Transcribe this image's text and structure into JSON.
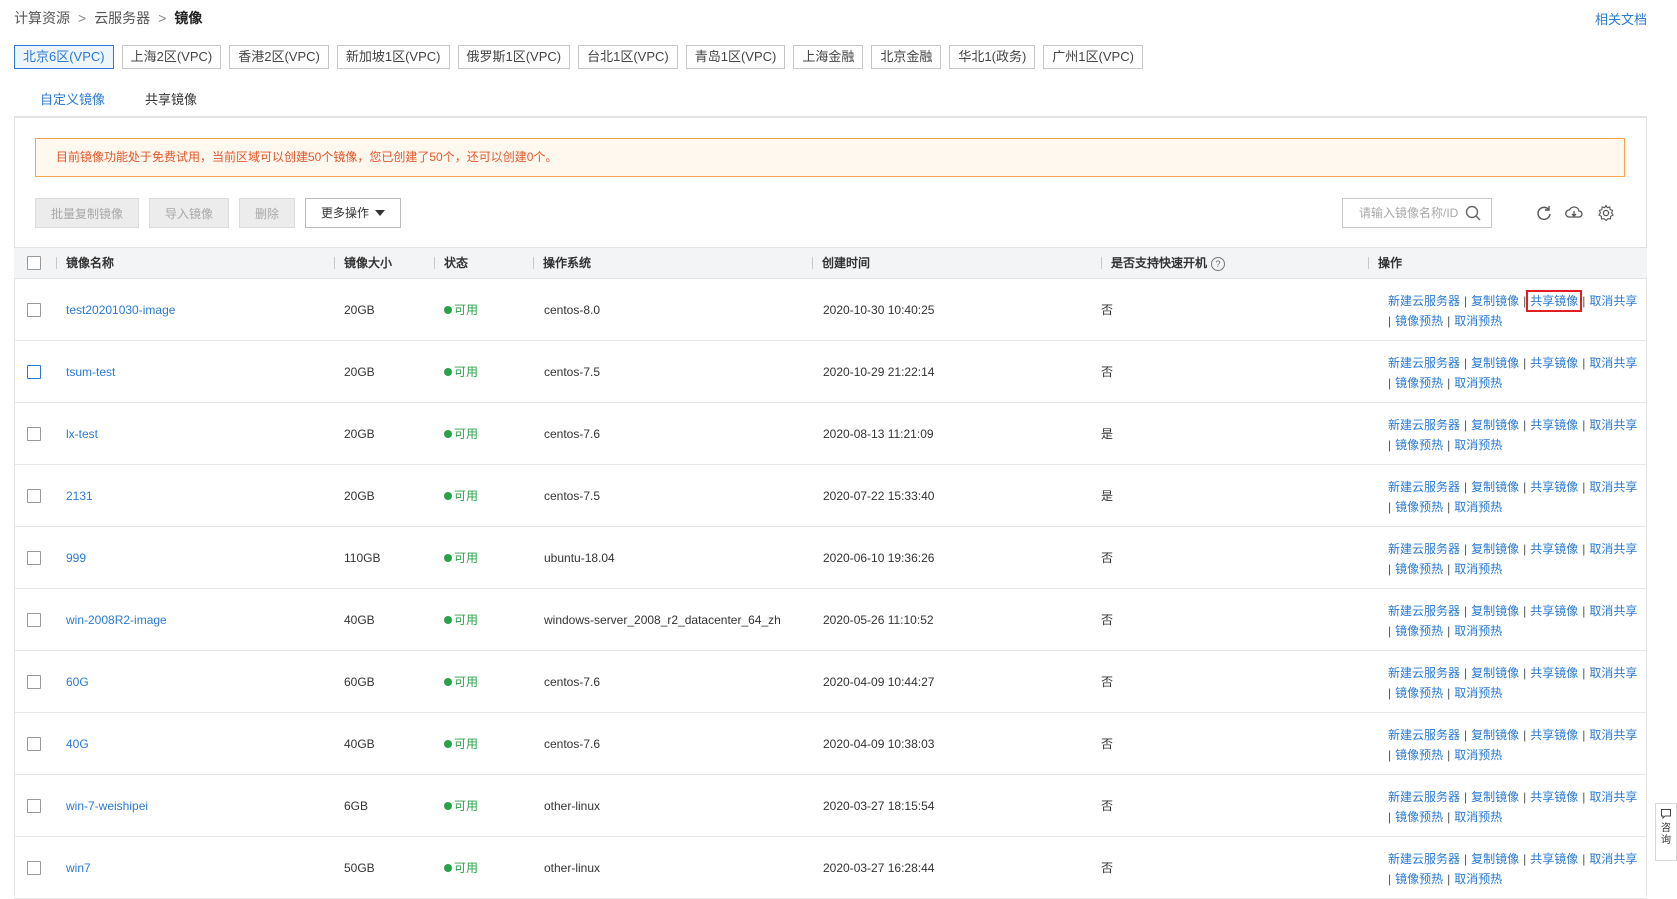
{
  "breadcrumb": {
    "items": [
      "计算资源",
      "云服务器",
      "镜像"
    ],
    "sep": ">"
  },
  "help_link": "相关文档",
  "regions": [
    "北京6区(VPC)",
    "上海2区(VPC)",
    "香港2区(VPC)",
    "新加坡1区(VPC)",
    "俄罗斯1区(VPC)",
    "台北1区(VPC)",
    "青岛1区(VPC)",
    "上海金融",
    "北京金融",
    "华北1(政务)",
    "广州1区(VPC)"
  ],
  "active_region": "北京6区(VPC)",
  "tabs": [
    "自定义镜像",
    "共享镜像"
  ],
  "notice": "目前镜像功能处于免费试用，当前区域可以创建50个镜像，您已创建了50个，还可以创建0个。",
  "toolbar": {
    "batch_copy": "批量复制镜像",
    "import": "导入镜像",
    "delete": "删除",
    "more": "更多操作"
  },
  "search": {
    "placeholder": "请输入镜像名称/ID"
  },
  "icons": {
    "search": "search-icon",
    "refresh": "refresh-icon",
    "download": "cloud-download-icon",
    "settings": "gear-icon",
    "help": "question-icon"
  },
  "columns": {
    "name": "镜像名称",
    "size": "镜像大小",
    "status": "状态",
    "os": "操作系统",
    "created": "创建时间",
    "fast_boot": "是否支持快速开机",
    "actions": "操作"
  },
  "action_labels": {
    "new_server": "新建云服务器",
    "copy": "复制镜像",
    "share": "共享镜像",
    "unshare": "取消共享",
    "preheat": "镜像预热",
    "cancel_preheat": "取消预热",
    "pipe": "|"
  },
  "rows": [
    {
      "name": "test20201030-image",
      "size": "20GB",
      "status": "可用",
      "os": "centos-8.0",
      "created": "2020-10-30 10:40:25",
      "fast_boot": "否"
    },
    {
      "name": "tsum-test",
      "size": "20GB",
      "status": "可用",
      "os": "centos-7.5",
      "created": "2020-10-29 21:22:14",
      "fast_boot": "否"
    },
    {
      "name": "lx-test",
      "size": "20GB",
      "status": "可用",
      "os": "centos-7.6",
      "created": "2020-08-13 11:21:09",
      "fast_boot": "是"
    },
    {
      "name": "2131",
      "size": "20GB",
      "status": "可用",
      "os": "centos-7.5",
      "created": "2020-07-22 15:33:40",
      "fast_boot": "是"
    },
    {
      "name": "999",
      "size": "110GB",
      "status": "可用",
      "os": "ubuntu-18.04",
      "created": "2020-06-10 19:36:26",
      "fast_boot": "否"
    },
    {
      "name": "win-2008R2-image",
      "size": "40GB",
      "status": "可用",
      "os": "windows-server_2008_r2_datacenter_64_zh",
      "created": "2020-05-26 11:10:52",
      "fast_boot": "否"
    },
    {
      "name": "60G",
      "size": "60GB",
      "status": "可用",
      "os": "centos-7.6",
      "created": "2020-04-09 10:44:27",
      "fast_boot": "否"
    },
    {
      "name": "40G",
      "size": "40GB",
      "status": "可用",
      "os": "centos-7.6",
      "created": "2020-04-09 10:38:03",
      "fast_boot": "否"
    },
    {
      "name": "win-7-weishipei",
      "size": "6GB",
      "status": "可用",
      "os": "other-linux",
      "created": "2020-03-27 18:15:54",
      "fast_boot": "否"
    },
    {
      "name": "win7",
      "size": "50GB",
      "status": "可用",
      "os": "other-linux",
      "created": "2020-03-27 16:28:44",
      "fast_boot": "否"
    }
  ],
  "float_service": [
    "咨",
    "询"
  ]
}
